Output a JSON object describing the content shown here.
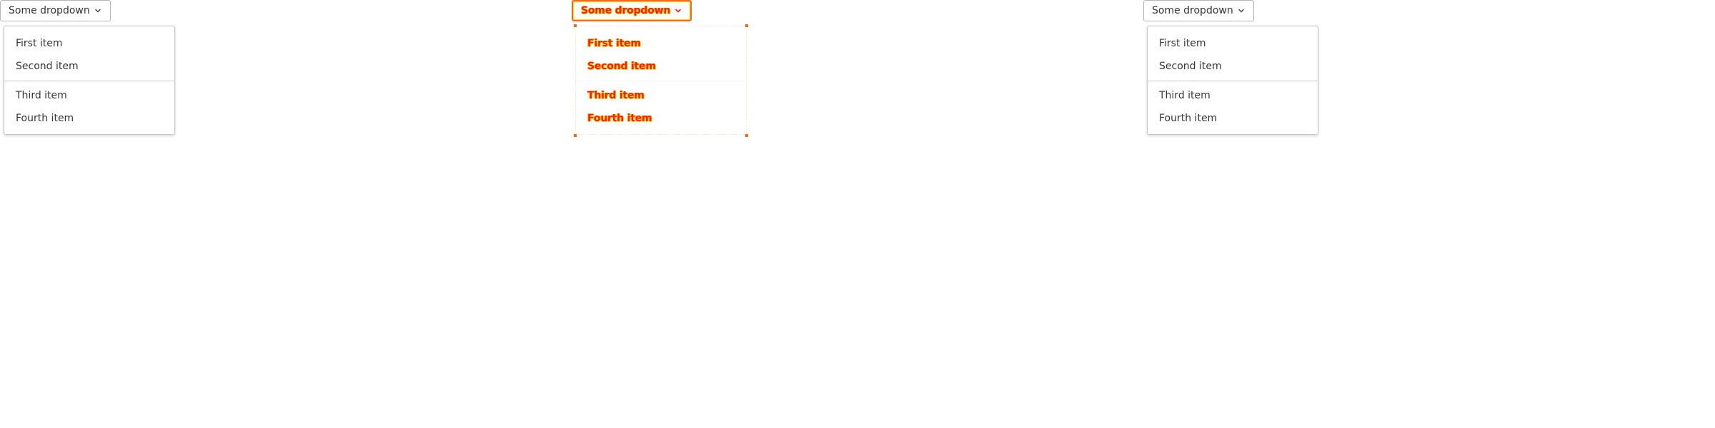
{
  "dropdown": {
    "button_label": "Some dropdown",
    "chevron_icon": "chevron-down-icon",
    "items": [
      {
        "label": "First item"
      },
      {
        "label": "Second item"
      },
      {
        "label": "Third item"
      },
      {
        "label": "Fourth item"
      }
    ]
  },
  "colors": {
    "diff_text": "#ff1a00",
    "diff_outline": "#f26b1d",
    "diff_highlight": "#ffcc00",
    "border": "#b5b5b5",
    "text": "#363636"
  }
}
